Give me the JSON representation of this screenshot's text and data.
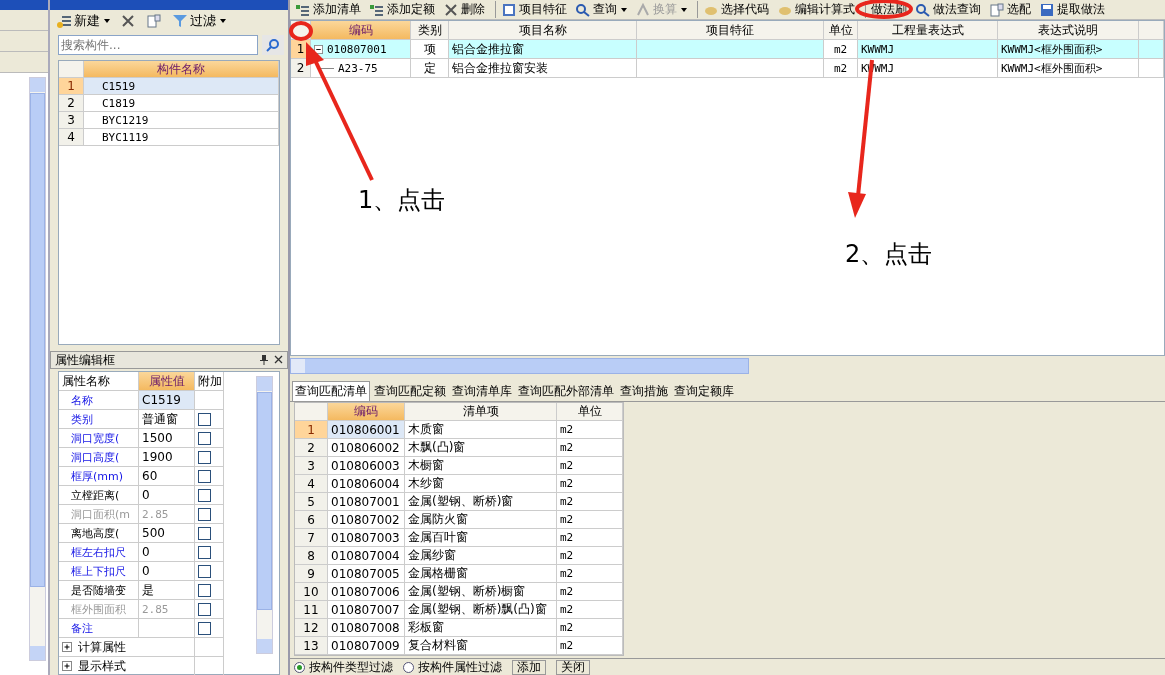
{
  "component_panel": {
    "toolbar": [
      {
        "kind": "new",
        "label": "新建",
        "dropdown": true
      },
      {
        "kind": "delete",
        "dropdown": false
      },
      {
        "kind": "copy",
        "dropdown": false
      },
      {
        "kind": "filter",
        "label": "过滤",
        "dropdown": true
      }
    ],
    "search": {
      "placeholder": "搜索构件..."
    },
    "table": {
      "columns": [
        "构件名称"
      ],
      "rows": [
        {
          "index": "1",
          "name": "C1519",
          "selected": true
        },
        {
          "index": "2",
          "name": "C1819",
          "selected": false
        },
        {
          "index": "3",
          "name": "BYC1219",
          "selected": false
        },
        {
          "index": "4",
          "name": "BYC1119",
          "selected": false
        }
      ]
    }
  },
  "properties": {
    "title": "属性编辑框",
    "columns": [
      "属性名称",
      "属性值",
      "附加"
    ],
    "rows": [
      {
        "name": "名称",
        "value": "C1519",
        "kind": "common",
        "selected": true
      },
      {
        "name": "类别",
        "value": "普通窗",
        "kind": "common",
        "selected": false,
        "checked": false
      },
      {
        "name": "洞口宽度(",
        "value": "1500",
        "kind": "common",
        "selected": false,
        "checked": false
      },
      {
        "name": "洞口高度(",
        "value": "1900",
        "kind": "common",
        "selected": false,
        "checked": false
      },
      {
        "name": "框厚(mm)",
        "value": "60",
        "kind": "common",
        "selected": false,
        "checked": false
      },
      {
        "name": "立樘距离(",
        "value": "0",
        "kind": "private",
        "selected": false,
        "checked": false
      },
      {
        "name": "洞口面积(m",
        "value": "2.85",
        "kind": "readonly",
        "selected": false,
        "checked": false
      },
      {
        "name": "离地高度(",
        "value": "500",
        "kind": "private",
        "selected": false,
        "checked": false
      },
      {
        "name": "框左右扣尺",
        "value": "0",
        "kind": "common",
        "selected": false,
        "checked": false
      },
      {
        "name": "框上下扣尺",
        "value": "0",
        "kind": "common",
        "selected": false,
        "checked": false
      },
      {
        "name": "是否随墙变",
        "value": "是",
        "kind": "private",
        "selected": false,
        "checked": false
      },
      {
        "name": "框外围面积",
        "value": "2.85",
        "kind": "readonly",
        "selected": false,
        "checked": false
      },
      {
        "name": "备注",
        "kind": "common",
        "selected": false,
        "checked": false
      }
    ],
    "groups": [
      {
        "label": "计算属性",
        "expanded": false
      },
      {
        "label": "显示样式",
        "expanded": false
      }
    ]
  },
  "toolbar": [
    {
      "kind": "add-list",
      "label": "添加清单",
      "separator_before": false,
      "dropdown": false,
      "disabled": false
    },
    {
      "kind": "add-quota",
      "label": "添加定额",
      "separator_before": false,
      "dropdown": false,
      "disabled": false
    },
    {
      "kind": "delete",
      "label": "删除",
      "separator_before": false,
      "dropdown": false,
      "disabled": false
    },
    {
      "kind": "feature",
      "label": "项目特征",
      "separator_before": true,
      "dropdown": false,
      "disabled": false
    },
    {
      "kind": "query",
      "label": "查询",
      "separator_before": false,
      "dropdown": true,
      "disabled": false
    },
    {
      "kind": "convert",
      "label": "换算",
      "separator_before": false,
      "dropdown": true,
      "disabled": true
    },
    {
      "kind": "choose-code",
      "label": "选择代码",
      "separator_before": true,
      "dropdown": false,
      "disabled": false
    },
    {
      "kind": "edit-formula",
      "label": "编辑计算式",
      "separator_before": false,
      "dropdown": false,
      "disabled": false
    },
    {
      "kind": "brush",
      "label": "做法刷",
      "separator_before": true,
      "dropdown": false,
      "disabled": false
    },
    {
      "kind": "method-query",
      "label": "做法查询",
      "separator_before": false,
      "dropdown": false,
      "disabled": false
    },
    {
      "kind": "match",
      "label": "选配",
      "separator_before": false,
      "dropdown": false,
      "disabled": false
    },
    {
      "kind": "extract",
      "label": "提取做法",
      "separator_before": false,
      "dropdown": false,
      "disabled": false
    }
  ],
  "method_table": {
    "columns": [
      "编码",
      "类别",
      "项目名称",
      "项目特征",
      "单位",
      "工程量表达式",
      "表达式说明"
    ],
    "rows": [
      {
        "index": "1",
        "code": "010807001",
        "type": "项",
        "name": "铝合金推拉窗",
        "unit": "m2",
        "expression": "KWWMJ",
        "description": "KWWMJ<框外围面积>",
        "selected": true,
        "expanded": true,
        "children": [
          {
            "index": "2",
            "code": "A23-75",
            "type": "定",
            "name": "铝合金推拉窗安装",
            "unit": "m2",
            "expression": "KWWMJ",
            "description": "KWWMJ<框外围面积>",
            "selected": false
          }
        ]
      }
    ]
  },
  "query_tabs": [
    {
      "label": "查询匹配清单",
      "selected": true
    },
    {
      "label": "查询匹配定额",
      "selected": false
    },
    {
      "label": "查询清单库",
      "selected": false
    },
    {
      "label": "查询匹配外部清单",
      "selected": false
    },
    {
      "label": "查询措施",
      "selected": false
    },
    {
      "label": "查询定额库",
      "selected": false
    }
  ],
  "query_table": {
    "columns": [
      "编码",
      "清单项",
      "单位"
    ],
    "rows": [
      {
        "index": "1",
        "code": "010806001",
        "item": "木质窗",
        "unit": "m2",
        "selected": true
      },
      {
        "index": "2",
        "code": "010806002",
        "item": "木飘(凸)窗",
        "unit": "m2",
        "selected": false
      },
      {
        "index": "3",
        "code": "010806003",
        "item": "木橱窗",
        "unit": "m2",
        "selected": false
      },
      {
        "index": "4",
        "code": "010806004",
        "item": "木纱窗",
        "unit": "m2",
        "selected": false
      },
      {
        "index": "5",
        "code": "010807001",
        "item": "金属(塑钢、断桥)窗",
        "unit": "m2",
        "selected": false
      },
      {
        "index": "6",
        "code": "010807002",
        "item": "金属防火窗",
        "unit": "m2",
        "selected": false
      },
      {
        "index": "7",
        "code": "010807003",
        "item": "金属百叶窗",
        "unit": "m2",
        "selected": false
      },
      {
        "index": "8",
        "code": "010807004",
        "item": "金属纱窗",
        "unit": "m2",
        "selected": false
      },
      {
        "index": "9",
        "code": "010807005",
        "item": "金属格栅窗",
        "unit": "m2",
        "selected": false
      },
      {
        "index": "10",
        "code": "010807006",
        "item": "金属(塑钢、断桥)橱窗",
        "unit": "m2",
        "selected": false
      },
      {
        "index": "11",
        "code": "010807007",
        "item": "金属(塑钢、断桥)飘(凸)窗",
        "unit": "m2",
        "selected": false
      },
      {
        "index": "12",
        "code": "010807008",
        "item": "彩板窗",
        "unit": "m2",
        "selected": false
      },
      {
        "index": "13",
        "code": "010807009",
        "item": "复合材料窗",
        "unit": "m2",
        "selected": false
      }
    ]
  },
  "filter_bar": {
    "options": [
      {
        "label": "按构件类型过滤",
        "selected": true
      },
      {
        "label": "按构件属性过滤",
        "selected": false
      }
    ],
    "buttons": [
      "添加",
      "关闭"
    ]
  },
  "annotations": [
    {
      "text": "1、点击"
    },
    {
      "text": "2、点击"
    }
  ]
}
